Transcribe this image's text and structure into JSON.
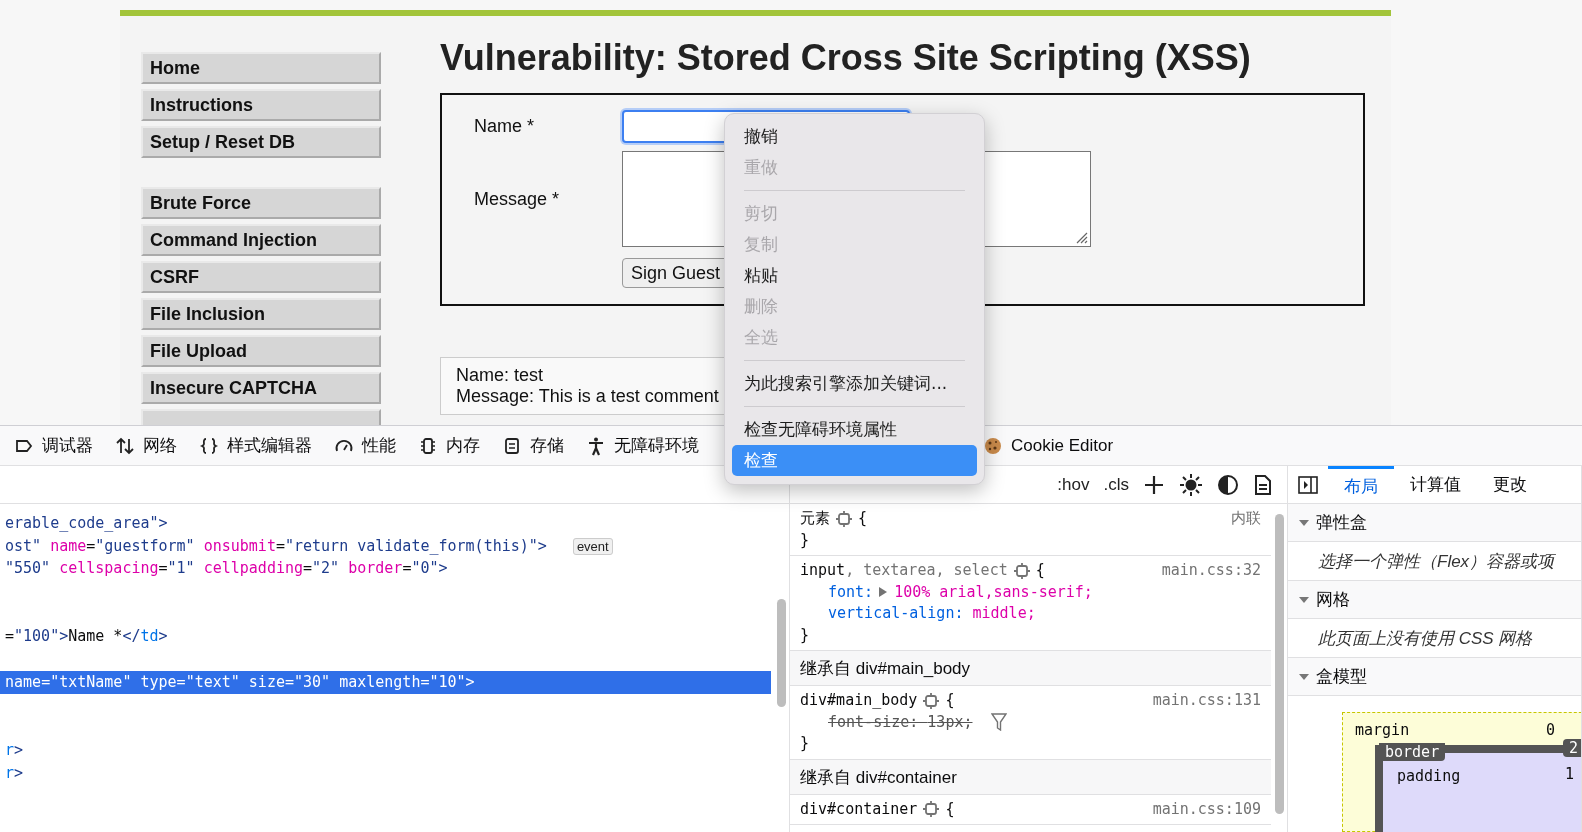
{
  "page": {
    "title": "Vulnerability: Stored Cross Site Scripting (XSS)",
    "menu_groups": [
      {
        "items": [
          {
            "kind": "full",
            "label": "Home"
          },
          {
            "kind": "full",
            "label": "Instructions"
          },
          {
            "kind": "full",
            "label": "Setup / Reset DB"
          }
        ]
      },
      {
        "items": [
          {
            "kind": "full",
            "label": "Brute Force"
          },
          {
            "kind": "full",
            "label": "Command Injection"
          },
          {
            "kind": "full",
            "label": "CSRF"
          },
          {
            "kind": "full",
            "label": "File Inclusion"
          },
          {
            "kind": "full",
            "label": "File Upload"
          },
          {
            "kind": "full",
            "label": "Insecure CAPTCHA"
          },
          {
            "kind": "cut"
          }
        ]
      }
    ],
    "form": {
      "fields": [
        {
          "label": "Name *",
          "kind": "input",
          "focused": true
        },
        {
          "label": "Message *",
          "kind": "textarea",
          "focused": false
        }
      ],
      "button": "Sign Guest"
    },
    "entries": [
      {
        "lines": [
          "Name: test",
          "Message: This is a test comment"
        ]
      }
    ]
  },
  "devtools": {
    "tabs": [
      {
        "label": "调试器",
        "kind": "debugger",
        "selected": false
      },
      {
        "label": "网络",
        "kind": "network",
        "selected": false
      },
      {
        "label": "样式编辑器",
        "kind": "style",
        "selected": false
      },
      {
        "label": "性能",
        "kind": "performance",
        "selected": false
      },
      {
        "label": "内存",
        "kind": "memory",
        "selected": false
      },
      {
        "label": "存储",
        "kind": "storage",
        "selected": false
      },
      {
        "label": "无障碍环境",
        "kind": "accessibility",
        "selected": false
      },
      {
        "label": "Cookie Editor",
        "kind": "cookie",
        "selected": false
      }
    ],
    "markup": {
      "lines": [
        {
          "kind": "code",
          "selected": false,
          "tokens": [
            {
              "kind": "val",
              "text": "erable_code_area\">"
            }
          ]
        },
        {
          "kind": "code",
          "selected": false,
          "tokens": [
            {
              "kind": "val",
              "text": "ost\" "
            },
            {
              "kind": "attr",
              "text": "name"
            },
            {
              "kind": "plain",
              "text": "="
            },
            {
              "kind": "val",
              "text": "\"guestform\" "
            },
            {
              "kind": "attr",
              "text": "onsubmit"
            },
            {
              "kind": "plain",
              "text": "="
            },
            {
              "kind": "val",
              "text": "\"return validate_form(this)\">"
            },
            {
              "kind": "badge",
              "text": "event"
            }
          ]
        },
        {
          "kind": "code",
          "selected": false,
          "tokens": [
            {
              "kind": "val",
              "text": "\"550\" "
            },
            {
              "kind": "attr",
              "text": "cellspacing"
            },
            {
              "kind": "plain",
              "text": "="
            },
            {
              "kind": "val",
              "text": "\"1\" "
            },
            {
              "kind": "attr",
              "text": "cellpadding"
            },
            {
              "kind": "plain",
              "text": "="
            },
            {
              "kind": "val",
              "text": "\"2\" "
            },
            {
              "kind": "attr",
              "text": "border"
            },
            {
              "kind": "plain",
              "text": "="
            },
            {
              "kind": "val",
              "text": "\"0\">"
            }
          ]
        },
        {
          "kind": "blank"
        },
        {
          "kind": "blank"
        },
        {
          "kind": "code",
          "selected": false,
          "tokens": [
            {
              "kind": "plain",
              "text": "="
            },
            {
              "kind": "val",
              "text": "\"100\">"
            },
            {
              "kind": "plain",
              "text": "Name *"
            },
            {
              "kind": "val",
              "text": "</"
            },
            {
              "kind": "tag",
              "text": "td"
            },
            {
              "kind": "val",
              "text": ">"
            }
          ]
        },
        {
          "kind": "blank"
        },
        {
          "kind": "code",
          "selected": true,
          "tokens": [
            {
              "kind": "attr",
              "text": "name"
            },
            {
              "kind": "plain",
              "text": "="
            },
            {
              "kind": "val",
              "text": "\"txtName\" "
            },
            {
              "kind": "attr",
              "text": "type"
            },
            {
              "kind": "plain",
              "text": "="
            },
            {
              "kind": "val",
              "text": "\"text\" "
            },
            {
              "kind": "attr",
              "text": "size"
            },
            {
              "kind": "plain",
              "text": "="
            },
            {
              "kind": "val",
              "text": "\"30\" "
            },
            {
              "kind": "attr",
              "text": "maxlength"
            },
            {
              "kind": "plain",
              "text": "="
            },
            {
              "kind": "val",
              "text": "\"10\">"
            }
          ]
        },
        {
          "kind": "blank"
        },
        {
          "kind": "blank"
        },
        {
          "kind": "code",
          "selected": false,
          "tokens": [
            {
              "kind": "tag",
              "text": "r"
            },
            {
              "kind": "val",
              "text": ">"
            }
          ]
        },
        {
          "kind": "code",
          "selected": false,
          "tokens": [
            {
              "kind": "tag",
              "text": "r"
            },
            {
              "kind": "val",
              "text": ">"
            }
          ]
        }
      ]
    },
    "rules": {
      "tools": [
        ":hov",
        ".cls"
      ],
      "blocks": [
        {
          "kind": "rule",
          "selector": [
            {
              "text": "元素",
              "matched": true
            }
          ],
          "open": "{",
          "source": "内联",
          "close": "}"
        },
        {
          "kind": "rule",
          "selector": [
            {
              "text": "input",
              "matched": true
            },
            {
              "text": ", textarea, select",
              "matched": false
            }
          ],
          "open": "{",
          "source": "main.css:32",
          "props": [
            {
              "name": "font:",
              "value": "100% arial,sans-serif;",
              "expandable": true,
              "overridden": false
            },
            {
              "name": "vertical-align:",
              "value": "middle;",
              "expandable": false,
              "overridden": false
            }
          ],
          "close": "}"
        },
        {
          "kind": "inherited",
          "title": "继承自 div#main_body"
        },
        {
          "kind": "rule",
          "selector": [
            {
              "text": "div#main_body",
              "matched": true
            }
          ],
          "open": "{",
          "source": "main.css:131",
          "props": [
            {
              "name": "font-size:",
              "value": "13px;",
              "expandable": false,
              "overridden": true
            }
          ],
          "close": "}"
        },
        {
          "kind": "inherited",
          "title": "继承自 div#container"
        },
        {
          "kind": "rule",
          "selector": [
            {
              "text": "div#container",
              "matched": true
            }
          ],
          "open": "{",
          "source": "main.css:109"
        }
      ]
    },
    "layout": {
      "tabs": [
        {
          "label": "布局",
          "selected": true
        },
        {
          "label": "计算值",
          "selected": false
        },
        {
          "label": "更改",
          "selected": false
        }
      ],
      "sections": [
        {
          "title": "弹性盒",
          "expanded": true,
          "note": "选择一个弹性（Flex）容器或项"
        },
        {
          "title": "网格",
          "expanded": true,
          "note": "此页面上没有使用 CSS 网格"
        },
        {
          "title": "盒模型",
          "expanded": true
        }
      ],
      "box_model": [
        {
          "label": "margin",
          "value": "0"
        },
        {
          "label": "border",
          "value": "2"
        },
        {
          "label": "padding",
          "value": "1"
        }
      ]
    }
  },
  "context_menu": {
    "items": [
      {
        "kind": "item",
        "label": "撤销",
        "disabled": false,
        "selected": false
      },
      {
        "kind": "item",
        "label": "重做",
        "disabled": true,
        "selected": false
      },
      {
        "kind": "separator"
      },
      {
        "kind": "item",
        "label": "剪切",
        "disabled": true,
        "selected": false
      },
      {
        "kind": "item",
        "label": "复制",
        "disabled": true,
        "selected": false
      },
      {
        "kind": "item",
        "label": "粘贴",
        "disabled": false,
        "selected": false
      },
      {
        "kind": "item",
        "label": "删除",
        "disabled": true,
        "selected": false
      },
      {
        "kind": "item",
        "label": "全选",
        "disabled": true,
        "selected": false
      },
      {
        "kind": "separator"
      },
      {
        "kind": "item",
        "label": "为此搜索引擎添加关键词...",
        "disabled": false,
        "selected": false
      },
      {
        "kind": "separator"
      },
      {
        "kind": "item",
        "label": "检查无障碍环境属性",
        "disabled": false,
        "selected": false
      },
      {
        "kind": "item",
        "label": "检查",
        "disabled": false,
        "selected": true
      }
    ]
  }
}
